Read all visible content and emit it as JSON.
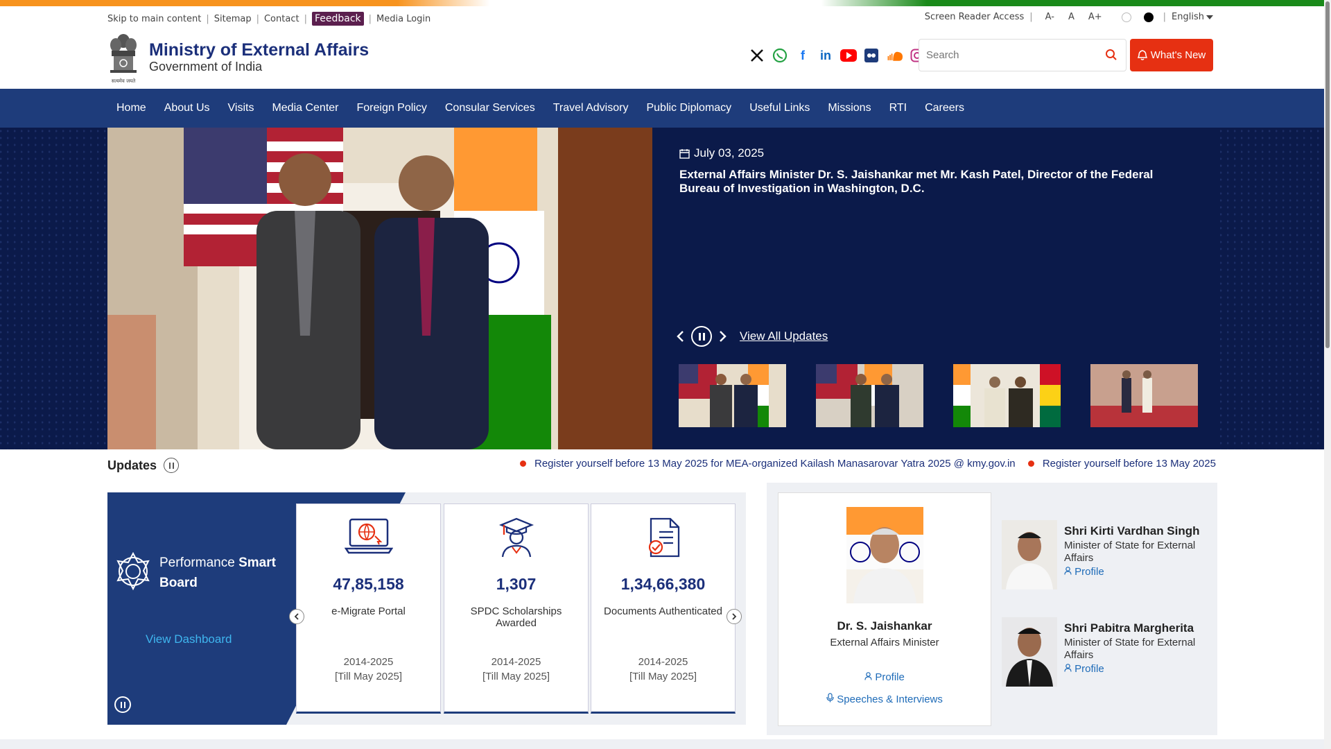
{
  "utility_bar": {
    "skip": "Skip to main content",
    "sitemap": "Sitemap",
    "contact": "Contact",
    "feedback": "Feedback",
    "media_login": "Media Login",
    "screen_reader": "Screen Reader Access",
    "font_decrease": "A-",
    "font_normal": "A",
    "font_increase": "A+",
    "language": "English"
  },
  "header": {
    "title": "Ministry of External Affairs",
    "subtitle": "Government of India",
    "emblem_motto": "सत्यमेव जयते",
    "social_icons": [
      "x-icon",
      "whatsapp-icon",
      "facebook-icon",
      "linkedin-icon",
      "youtube-icon",
      "flickr-icon",
      "soundcloud-icon",
      "instagram-icon"
    ],
    "search_placeholder": "Search",
    "whats_new": "What's New"
  },
  "nav": {
    "items": [
      "Home",
      "About Us",
      "Visits",
      "Media Center",
      "Foreign Policy",
      "Consular Services",
      "Travel Advisory",
      "Public Diplomacy",
      "Useful Links",
      "Missions",
      "RTI",
      "Careers"
    ]
  },
  "hero": {
    "date": "July 03, 2025",
    "headline": "External Affairs Minister Dr. S. Jaishankar met Mr. Kash Patel, Director of the Federal Bureau of Investigation in Washington, D.C.",
    "view_all": "View All Updates"
  },
  "updates": {
    "label": "Updates",
    "ticker": [
      "Register yourself before 13 May 2025 for MEA-organized Kailash Manasarovar Yatra 2025 @ kmy.gov.in",
      "Register yourself before 13 May 2025"
    ]
  },
  "smart_board": {
    "title_plain": "Performance",
    "title_bold_1": "Smart",
    "title_bold_2": "Board",
    "view_dashboard": "View Dashboard",
    "cards": [
      {
        "value": "47,85,158",
        "label": "e-Migrate Portal",
        "period_1": "2014-2025",
        "period_2": "[Till May 2025]"
      },
      {
        "value": "1,307",
        "label": "SPDC Scholarships Awarded",
        "period_1": "2014-2025",
        "period_2": "[Till May 2025]"
      },
      {
        "value": "1,34,66,380",
        "label": "Documents Authenticated",
        "period_1": "2014-2025",
        "period_2": "[Till May 2025]"
      }
    ]
  },
  "ministers": {
    "main": {
      "name": "Dr. S. Jaishankar",
      "role": "External Affairs Minister",
      "profile": "Profile",
      "speeches": "Speeches & Interviews"
    },
    "mos": [
      {
        "name": "Shri Kirti Vardhan Singh",
        "role": "Minister of State for External Affairs",
        "profile": "Profile"
      },
      {
        "name": "Shri Pabitra Margherita",
        "role": "Minister of State for External Affairs",
        "profile": "Profile"
      }
    ]
  },
  "colors": {
    "navy": "#1e3c7b",
    "hero_bg": "#0b1a4a",
    "accent_red": "#e63012",
    "feedback_bg": "#5b1f4e",
    "link_blue": "#1e6bb8"
  }
}
